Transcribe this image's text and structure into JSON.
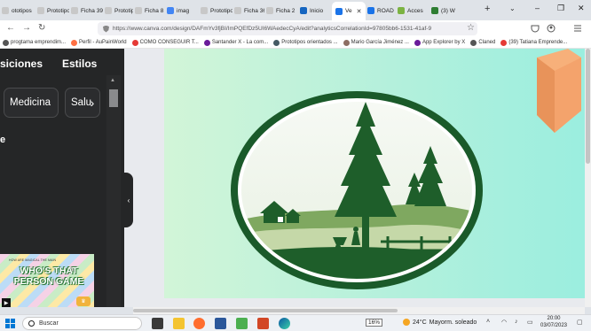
{
  "tabs": [
    {
      "label": "ototipos",
      "color": "#c8c8c8"
    },
    {
      "label": "Prototipo",
      "color": "#c8c8c8"
    },
    {
      "label": "Ficha 39",
      "color": "#c8c8c8"
    },
    {
      "label": "Prototipo",
      "color": "#c8c8c8"
    },
    {
      "label": "Ficha 8",
      "color": "#c8c8c8"
    },
    {
      "label": "imag",
      "color": "#4285f4"
    },
    {
      "label": "Prototipo",
      "color": "#c8c8c8"
    },
    {
      "label": "Ficha 36",
      "color": "#c8c8c8"
    },
    {
      "label": "Ficha 2",
      "color": "#c8c8c8"
    },
    {
      "label": "Inicio",
      "color": "#1565c0"
    },
    {
      "label": "Ve",
      "color": "#1a73e8",
      "active": true
    },
    {
      "label": "ROAD",
      "color": "#1a73e8"
    },
    {
      "label": "Acces",
      "color": "#7cb342"
    },
    {
      "label": "(3) W",
      "color": "#2e7d32"
    }
  ],
  "url": "https://www.canva.com/design/DAFmYv3fjBI/ImPQEfDz5UI6WAedecCyA/edit?analyticsCorrelationId=97805bb6-1531-41af-9",
  "bookmarks": [
    {
      "label": "progtama emprendim...",
      "color": "#555"
    },
    {
      "label": "Perfil - AuPainWorld",
      "color": "#ff7043"
    },
    {
      "label": "COMO CONSEGUIR T...",
      "color": "#e53935"
    },
    {
      "label": "Santander X - La com...",
      "color": "#6a1b9a"
    },
    {
      "label": "Prototipos orientados ...",
      "color": "#455a64"
    },
    {
      "label": "Mario García Jiménez ...",
      "color": "#8d6e63"
    },
    {
      "label": "App Explorer by X",
      "color": "#6a1b9a"
    },
    {
      "label": "Claned",
      "color": "#555"
    },
    {
      "label": "(39) Tatiana Emprende...",
      "color": "#e53935"
    }
  ],
  "sidebar": {
    "tab_left": "siciones",
    "tab_right": "Estilos",
    "chip1": "Medicina",
    "chip2": "Salu",
    "section_bullet": "e",
    "template": {
      "small_text": "HOW ARE MAGICAL THE MAIN",
      "title": "WHO'S THAT PERSON GAME"
    }
  },
  "taskbar": {
    "search_placeholder": "Buscar",
    "zoom_badge": "16%",
    "temperature": "24°C",
    "weather_text": "Mayorm. soleado",
    "time": "20:00",
    "date": "03/07/2023"
  }
}
